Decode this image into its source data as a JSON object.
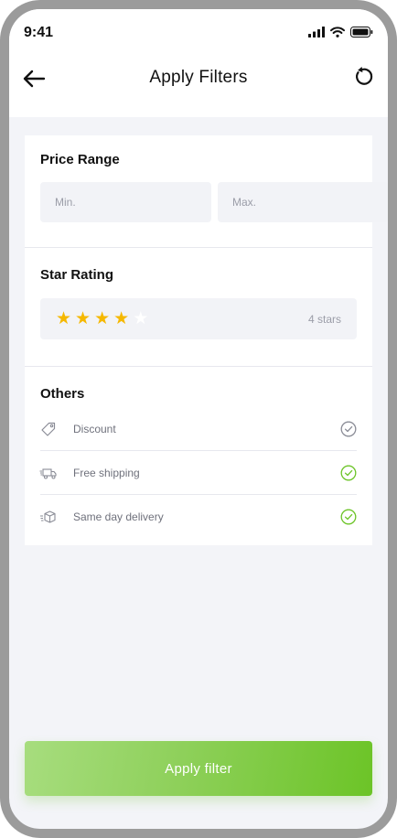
{
  "status_bar": {
    "time": "9:41",
    "icons": [
      "signal-icon",
      "wifi-icon",
      "battery-icon"
    ]
  },
  "header": {
    "title": "Apply Filters",
    "back_icon": "arrow-left-icon",
    "reset_icon": "refresh-icon"
  },
  "price_range": {
    "title": "Price Range",
    "min_placeholder": "Min.",
    "max_placeholder": "Max.",
    "min_value": "",
    "max_value": ""
  },
  "star_rating": {
    "title": "Star Rating",
    "value": 4,
    "max": 5,
    "label": "4 stars",
    "star_color": "#F5B800"
  },
  "others": {
    "title": "Others",
    "options": [
      {
        "label": "Discount",
        "icon": "tag-icon",
        "checked": false
      },
      {
        "label": "Free shipping",
        "icon": "truck-icon",
        "checked": true
      },
      {
        "label": "Same day delivery",
        "icon": "box-icon",
        "checked": true
      }
    ]
  },
  "footer": {
    "apply_label": "Apply filter",
    "gradient_start": "#A7DD7E",
    "gradient_end": "#6CC427"
  },
  "colors": {
    "background": "#F3F4F8",
    "accent_green": "#6CC427",
    "check_green": "#6CC427",
    "check_grey": "#8A8C96"
  }
}
